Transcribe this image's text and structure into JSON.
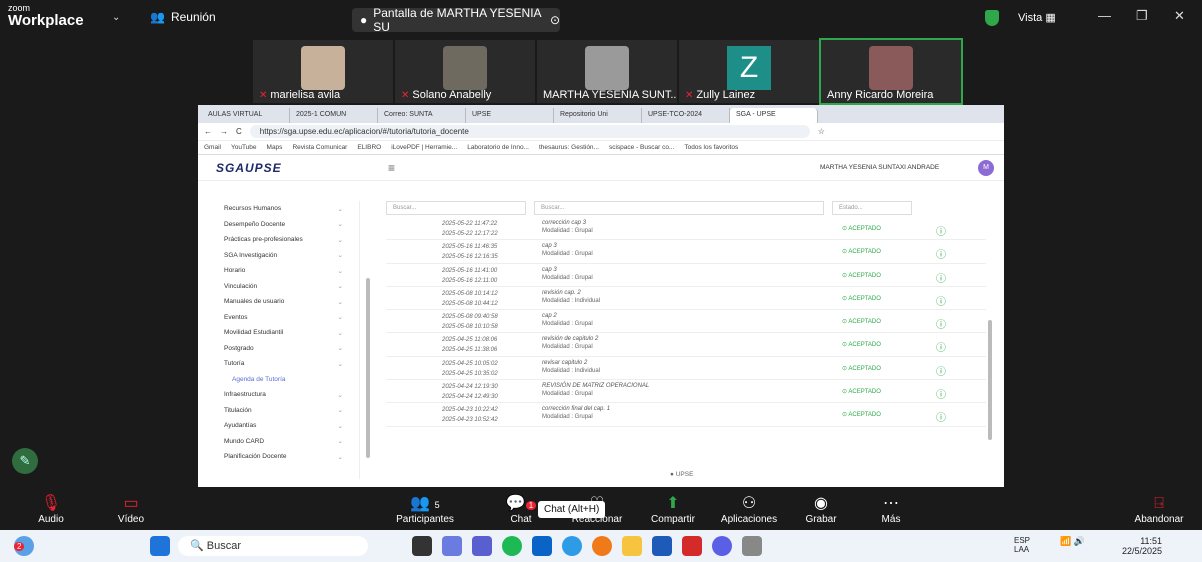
{
  "zoom": {
    "logo_top": "zoom",
    "logo_bottom": "Workplace",
    "meeting_label": "Reunión",
    "share_label": "Pantalla de MARTHA YESENIA SU",
    "view_label": "Vista",
    "colors": {
      "bg": "#1a1a1a",
      "accent": "#2ea84a",
      "danger": "#e23333"
    }
  },
  "participants": [
    {
      "name": "marielisa avila",
      "muted": true
    },
    {
      "name": "Solano Anabelly",
      "muted": true
    },
    {
      "name": "MARTHA YESENIA SUNT...",
      "muted": false
    },
    {
      "name": "Zully Lainez",
      "muted": true,
      "initial": "Z"
    },
    {
      "name": "Anny Ricardo Moreira",
      "muted": false
    }
  ],
  "browser": {
    "tabs": [
      "AULAS VIRTUAL",
      "2025-1 COMUN",
      "Correo: SUNTA",
      "UPSE",
      "Repositorio Uni",
      "UPSE-TCO-2024",
      "SGA - UPSE"
    ],
    "url": "https://sga.upse.edu.ec/aplicacion/#/tutoria/tutoria_docente",
    "bookmarks": [
      "Gmail",
      "YouTube",
      "Maps",
      "Revista Comunicar",
      "ELIBRO",
      "iLovePDF | Herramie...",
      "Laboratorio de Inno...",
      "thesaurus: Gestión...",
      "scispace - Buscar co..."
    ],
    "all_favorites": "Todos los favoritos"
  },
  "app": {
    "logo": "SGAUPSE",
    "user": "MARTHA YESENIA SUNTAXI ANDRADE",
    "user_initials": "M",
    "footer": "UPSE",
    "sidebar": [
      {
        "label": "Recursos Humanos",
        "sub": false
      },
      {
        "label": "Desempeño Docente",
        "sub": false
      },
      {
        "label": "Prácticas pre-profesionales",
        "sub": false
      },
      {
        "label": "SGA Investigación",
        "sub": false
      },
      {
        "label": "Horario",
        "sub": false
      },
      {
        "label": "Vinculación",
        "sub": false
      },
      {
        "label": "Manuales de usuario",
        "sub": false
      },
      {
        "label": "Eventos",
        "sub": false
      },
      {
        "label": "Movilidad Estudiantil",
        "sub": false
      },
      {
        "label": "Postgrado",
        "sub": false
      },
      {
        "label": "Tutoría",
        "sub": false
      },
      {
        "label": "Agenda de Tutoría",
        "sub": true
      },
      {
        "label": "Infraestructura",
        "sub": false
      },
      {
        "label": "Titulación",
        "sub": false
      },
      {
        "label": "Ayudantías",
        "sub": false
      },
      {
        "label": "Mundo CARD",
        "sub": false
      },
      {
        "label": "Planificación Docente",
        "sub": false
      }
    ],
    "filters": {
      "search1": "Buscar...",
      "search2": "Buscar...",
      "state": "Estado..."
    },
    "rows": [
      {
        "start": "2025-05-22 11:47:22",
        "end": "2025-05-22 12:17:22",
        "topic": "corrección cap 3",
        "mode": "Modalidad : Grupal",
        "status": "ACEPTADO"
      },
      {
        "start": "2025-05-16 11:46:35",
        "end": "2025-05-16 12:16:35",
        "topic": "cap 3",
        "mode": "Modalidad : Grupal",
        "status": "ACEPTADO"
      },
      {
        "start": "2025-05-16 11:41:00",
        "end": "2025-05-16 12:11:00",
        "topic": "cap 3",
        "mode": "Modalidad : Grupal",
        "status": "ACEPTADO"
      },
      {
        "start": "2025-05-08 10:14:12",
        "end": "2025-05-08 10:44:12",
        "topic": "revisión cap. 2",
        "mode": "Modalidad : Individual",
        "status": "ACEPTADO"
      },
      {
        "start": "2025-05-08 09:40:58",
        "end": "2025-05-08 10:10:58",
        "topic": "cap 2",
        "mode": "Modalidad : Grupal",
        "status": "ACEPTADO"
      },
      {
        "start": "2025-04-25 11:08:06",
        "end": "2025-04-25 11:38:06",
        "topic": "revisión de capitulo 2",
        "mode": "Modalidad : Grupal",
        "status": "ACEPTADO"
      },
      {
        "start": "2025-04-25 10:05:02",
        "end": "2025-04-25 10:35:02",
        "topic": "revisar capitulo 2",
        "mode": "Modalidad : Individual",
        "status": "ACEPTADO"
      },
      {
        "start": "2025-04-24 12:19:30",
        "end": "2025-04-24 12:49:30",
        "topic": "REVISIÓN DE MATRIZ OPERACIONAL",
        "mode": "Modalidad : Grupal",
        "status": "ACEPTADO"
      },
      {
        "start": "2025-04-23 10:22:42",
        "end": "2025-04-23 10:52:42",
        "topic": "corrección final del cap. 1",
        "mode": "Modalidad : Grupal",
        "status": "ACEPTADO"
      }
    ]
  },
  "toolbar": {
    "audio": "Audio",
    "video": "Vídeo",
    "participants": "Participantes",
    "participants_count": "5",
    "chat": "Chat",
    "chat_badge": "1",
    "chat_tooltip": "Chat (Alt+H)",
    "react": "Reaccionar",
    "share": "Compartir",
    "apps": "Aplicaciones",
    "record": "Grabar",
    "more": "Más",
    "leave": "Abandonar"
  },
  "taskbar": {
    "search": "Buscar",
    "lang1": "ESP",
    "lang2": "LAA",
    "time": "11:51",
    "date": "22/5/2025",
    "weather_badge": "2"
  }
}
